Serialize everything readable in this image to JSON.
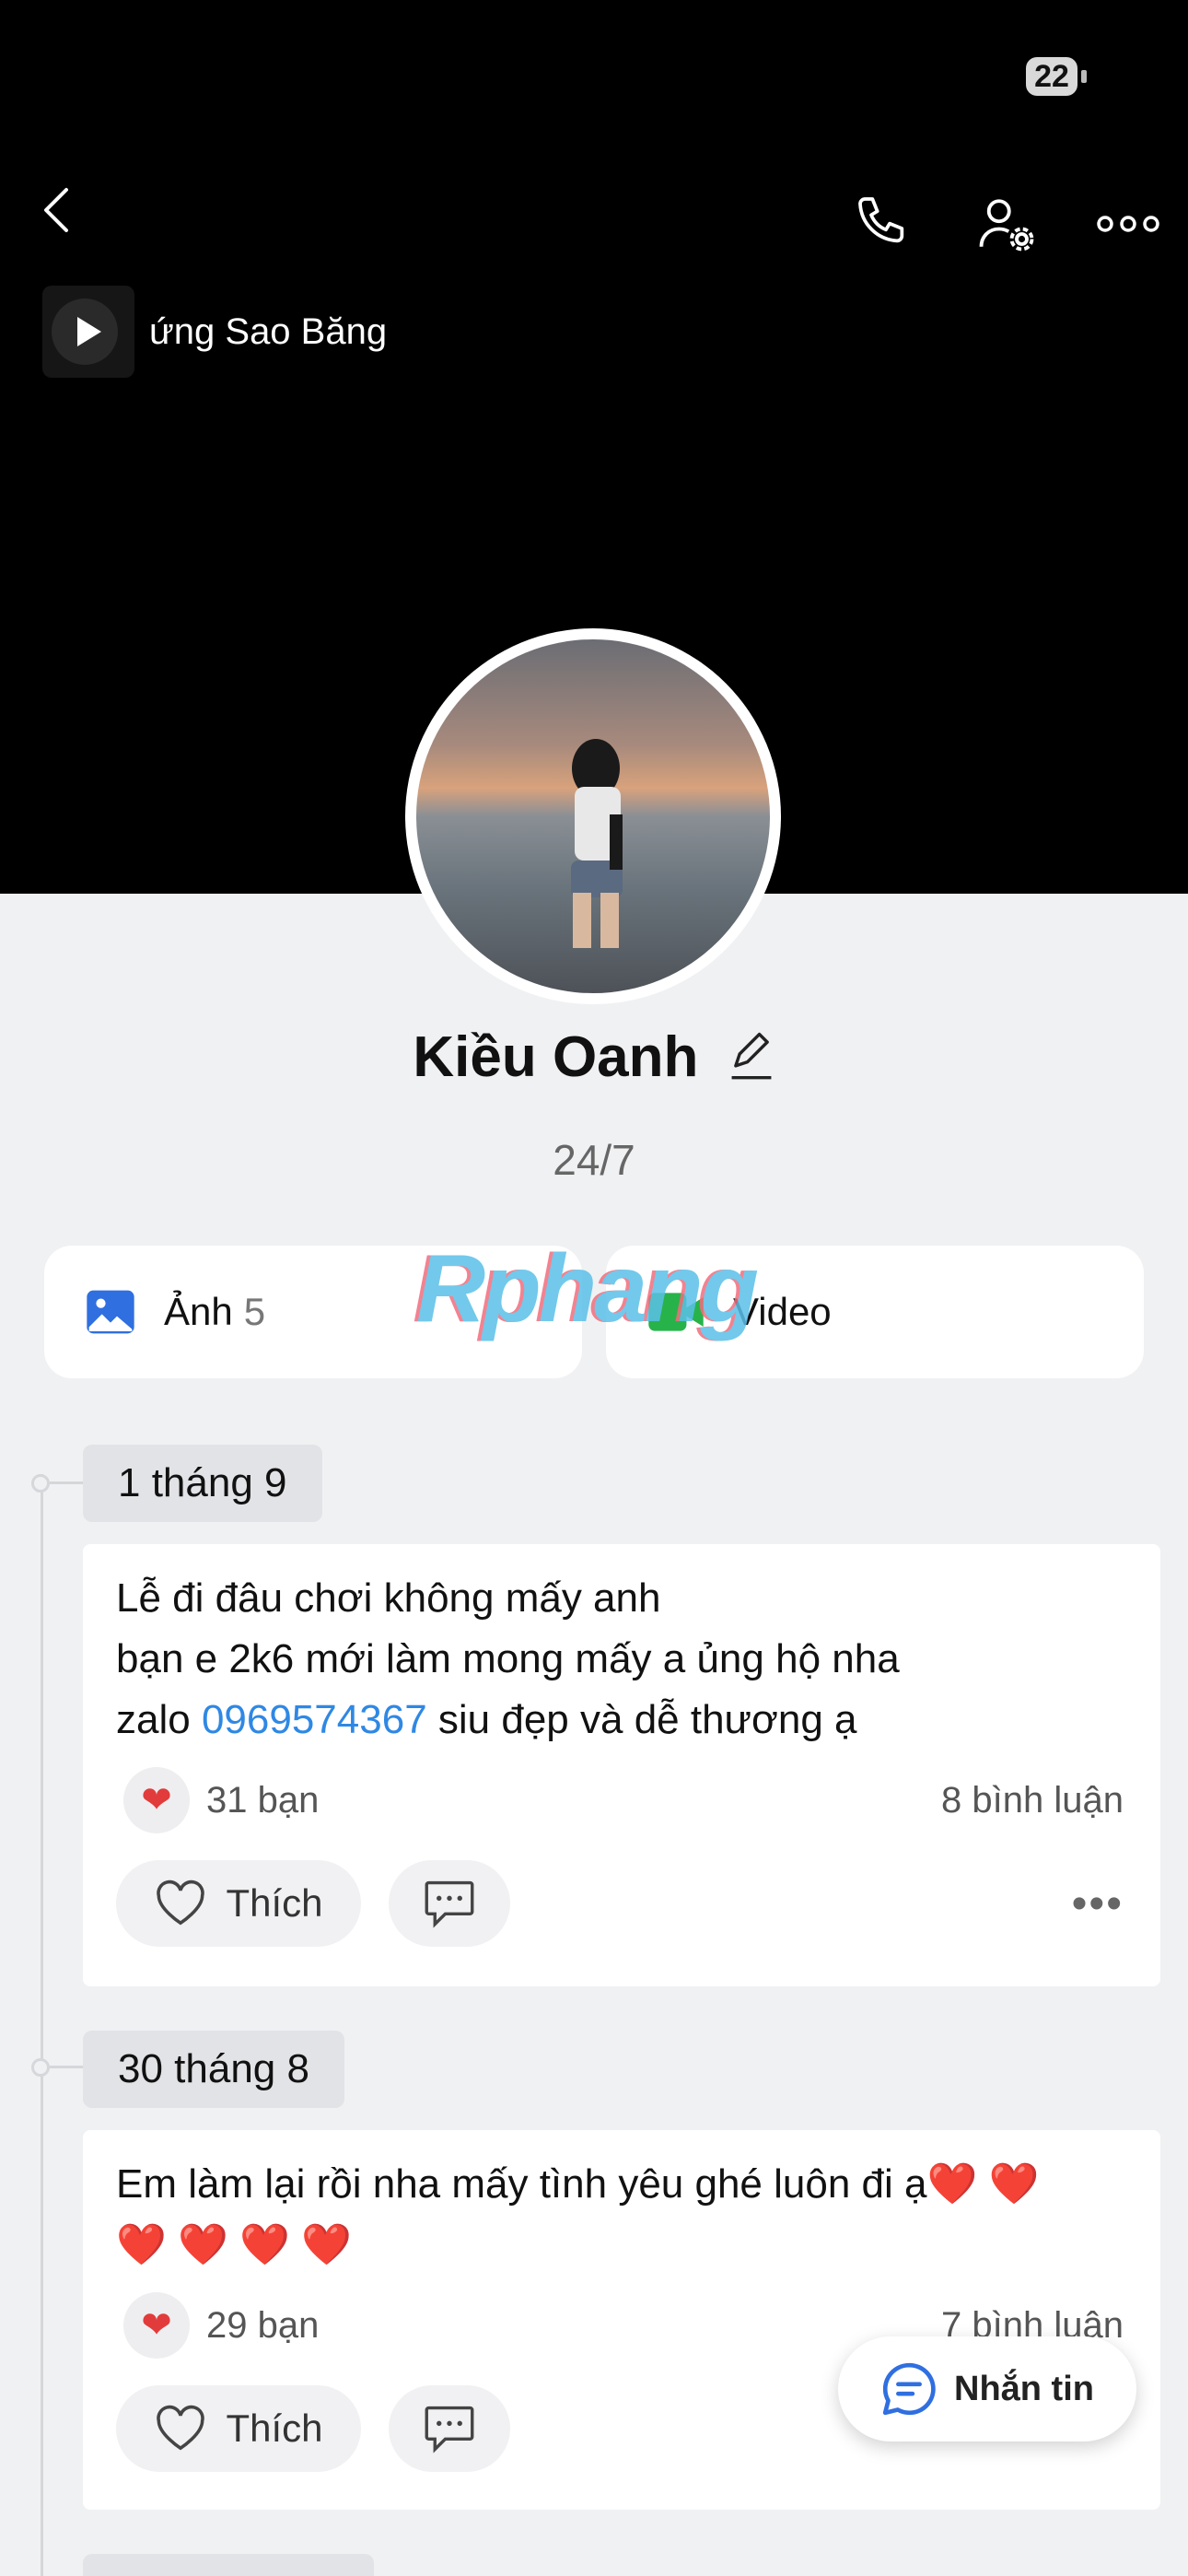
{
  "status_bar": {
    "battery": "22"
  },
  "music": {
    "title": "ứng Sao Băng"
  },
  "profile": {
    "name": "Kiều Oanh",
    "bio": "24/7"
  },
  "media": {
    "photos_label": "Ảnh",
    "photos_count": "5",
    "videos_label": "Video"
  },
  "watermark": "Rphang",
  "posts": [
    {
      "date": "1 tháng 9",
      "line1": "Lễ đi đâu chơi không mấy anh",
      "line2": "bạn e 2k6 mới làm mong mấy a ủng hộ nha",
      "line3_prefix": "zalo ",
      "line3_phone": "0969574367",
      "line3_suffix": " siu đẹp và dễ thương ạ",
      "likes": "31 bạn",
      "comments": "8 bình luận",
      "like_label": "Thích"
    },
    {
      "date": "30 tháng 8",
      "line1": "Em làm lại rồi nha mấy tình yêu ghé luôn đi ạ❤️ ❤️",
      "line2": "❤️ ❤️ ❤️ ❤️",
      "likes": "29 bạn",
      "comments": "7 bình luận",
      "like_label": "Thích"
    }
  ],
  "chat_button": {
    "label": "Nhắn tin"
  },
  "colors": {
    "link": "#2f88e4",
    "heart": "#e23b3b",
    "photo_icon": "#2f6fe0",
    "video_icon": "#27b34a"
  }
}
